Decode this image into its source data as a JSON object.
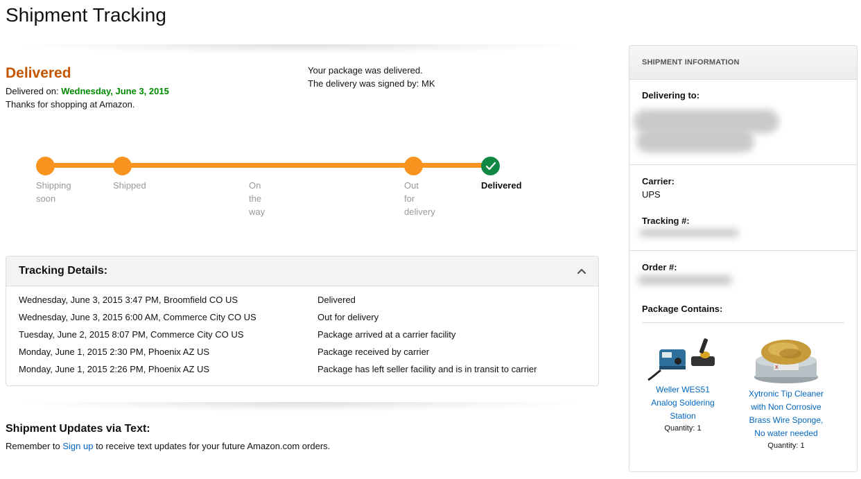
{
  "page": {
    "title": "Shipment Tracking"
  },
  "status": {
    "heading": "Delivered",
    "delivered_on_label": "Delivered on:",
    "delivered_date": "Wednesday, June 3, 2015",
    "thanks": "Thanks for shopping at Amazon.",
    "message_line1": "Your package was delivered.",
    "message_line2": "The delivery was signed by: MK"
  },
  "progress": {
    "steps": [
      {
        "line1": "Shipping",
        "line2": "soon",
        "line3": ""
      },
      {
        "line1": "Shipped",
        "line2": "",
        "line3": ""
      },
      {
        "line1": "On",
        "line2": "the",
        "line3": "way"
      },
      {
        "line1": "Out",
        "line2": "for",
        "line3": "delivery"
      },
      {
        "line1": "Delivered",
        "line2": "",
        "line3": ""
      }
    ],
    "current_step": 5,
    "colors": {
      "active": "#f7931e",
      "complete": "#108743"
    }
  },
  "tracking": {
    "title": "Tracking Details:",
    "rows": [
      {
        "date": "Wednesday, June 3, 2015 3:47 PM, Broomfield CO US",
        "status": "Delivered"
      },
      {
        "date": "Wednesday, June 3, 2015 6:00 AM, Commerce City CO US",
        "status": "Out for delivery"
      },
      {
        "date": "Tuesday, June 2, 2015 8:07 PM, Commerce City CO US",
        "status": "Package arrived at a carrier facility"
      },
      {
        "date": "Monday, June 1, 2015 2:30 PM, Phoenix AZ US",
        "status": "Package received by carrier"
      },
      {
        "date": "Monday, June 1, 2015 2:26 PM, Phoenix AZ US",
        "status": "Package has left seller facility and is in transit to carrier"
      }
    ]
  },
  "updates": {
    "title": "Shipment Updates via Text:",
    "prefix": "Remember to",
    "link": "Sign up",
    "suffix": "to receive text updates for your future Amazon.com orders."
  },
  "info": {
    "header": "SHIPMENT INFORMATION",
    "delivering_label": "Delivering to:",
    "carrier_label": "Carrier:",
    "carrier_value": "UPS",
    "tracking_label": "Tracking #:",
    "order_label": "Order #:",
    "package_label": "Package Contains:",
    "products": [
      {
        "name_lines": [
          "Weller WES51",
          "Analog Soldering",
          "Station"
        ],
        "qty": "Quantity: 1"
      },
      {
        "name_lines": [
          "Xytronic Tip Cleaner",
          "with Non Corrosive",
          "Brass Wire Sponge,",
          "No water needed"
        ],
        "qty": "Quantity: 1"
      }
    ]
  },
  "colors": {
    "status_orange": "#c45500",
    "date_green": "#008a00",
    "link_blue": "#0066c0"
  }
}
